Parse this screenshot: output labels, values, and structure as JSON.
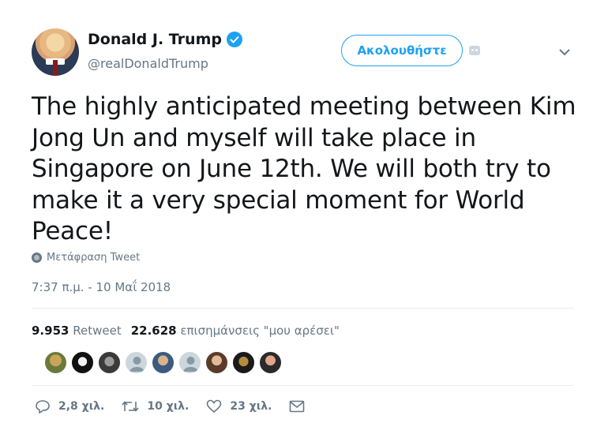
{
  "author": {
    "display_name": "Donald J. Trump",
    "handle": "@realDonaldTrump",
    "verified_icon": "verified-badge-icon"
  },
  "follow_button_label": "Ακολουθήστε",
  "tweet": {
    "text": "The highly anticipated meeting between Kim Jong Un and myself will take place in Singapore on June 12th. We will both try to make it a very special moment for World Peace!",
    "translate_label": "Μετάφραση Tweet",
    "timestamp": "7:37 π.μ. - 10 Μαΐ 2018"
  },
  "stats": {
    "retweets_count": "9.953",
    "retweets_label": "Retweet",
    "likes_count": "22.628",
    "likes_label": "επισημάνσεις \"μου αρέσει\""
  },
  "liker_avatars": [
    "avatar-1",
    "avatar-2",
    "avatar-3",
    "avatar-4",
    "avatar-5",
    "avatar-6",
    "avatar-7",
    "avatar-8",
    "avatar-9"
  ],
  "actions": {
    "replies": "2,8 χιλ.",
    "retweets": "10 χιλ.",
    "likes": "23 χιλ."
  },
  "colors": {
    "accent": "#1da1f2",
    "secondary_text": "#657786",
    "primary_text": "#14171a"
  }
}
